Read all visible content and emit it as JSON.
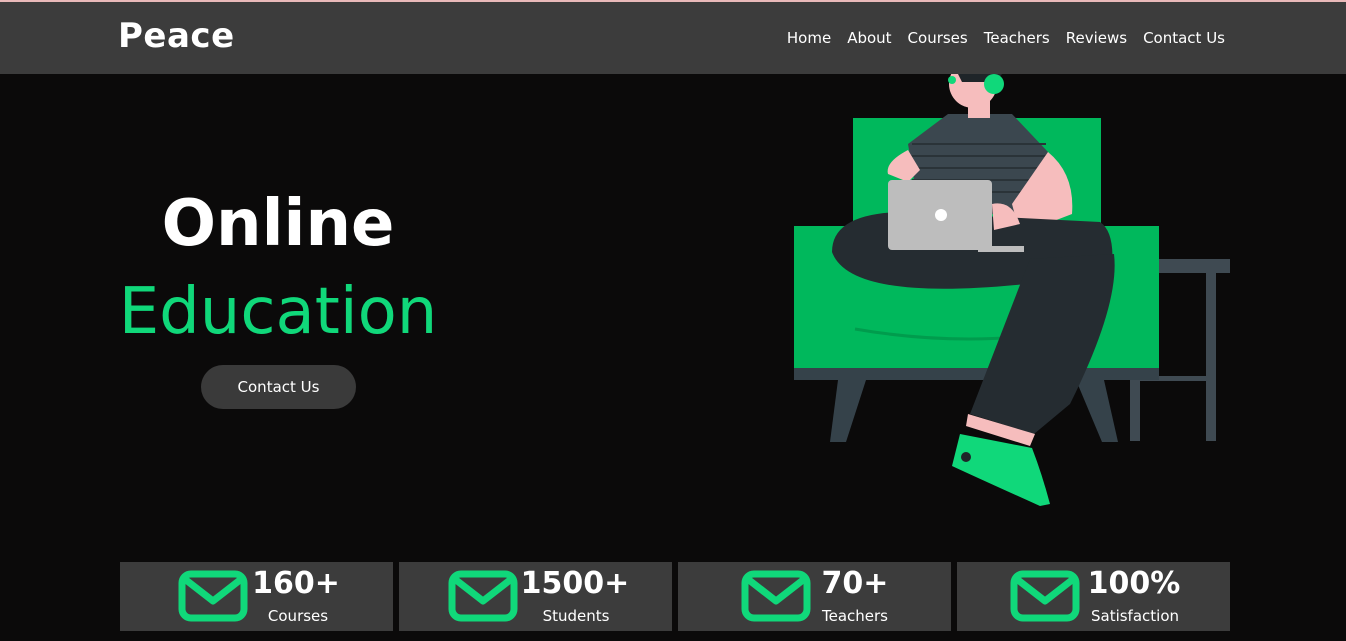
{
  "brand": "Peace",
  "nav": [
    "Home",
    "About",
    "Courses",
    "Teachers",
    "Reviews",
    "Contact Us"
  ],
  "hero": {
    "line1": "Online",
    "line2": "Education",
    "button": "Contact Us"
  },
  "stats": [
    {
      "value": "160+",
      "label": "Courses"
    },
    {
      "value": "1500+",
      "label": "Students"
    },
    {
      "value": "70+",
      "label": "Teachers"
    },
    {
      "value": "100%",
      "label": "Satisfaction"
    }
  ],
  "colors": {
    "accent": "#10d87a",
    "header_bg": "#3c3c3c",
    "page_bg": "#0b0a0a",
    "chair_green": "#00b85c"
  },
  "icons": {
    "stat_icon": "mail-icon"
  }
}
